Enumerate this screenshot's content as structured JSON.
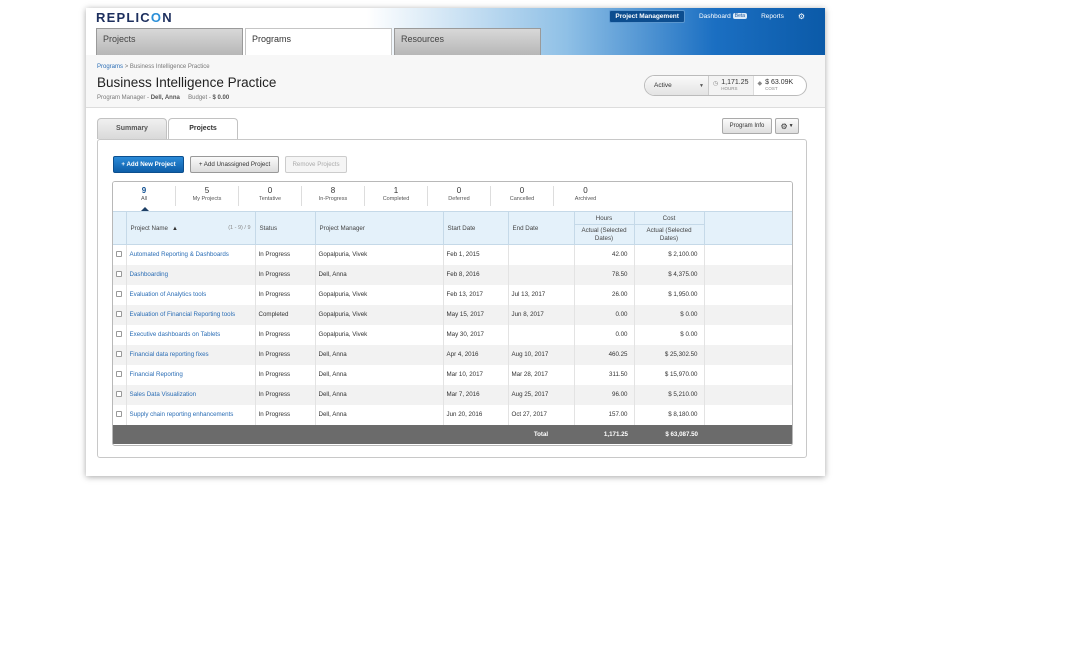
{
  "header": {
    "logo": {
      "left": "REPLIC",
      "o": "O",
      "right": "N"
    },
    "nav": [
      {
        "label": "Project Management",
        "active": true
      },
      {
        "label": "Dashboard",
        "badge": "Beta"
      },
      {
        "label": "Reports"
      }
    ],
    "settings_icon": "gear-icon"
  },
  "main_tabs": [
    {
      "label": "Projects"
    },
    {
      "label": "Programs",
      "active": true
    },
    {
      "label": "Resources"
    }
  ],
  "breadcrumb": {
    "link": "Programs",
    "sep": ">",
    "current": "Business Intelligence Practice"
  },
  "page": {
    "title": "Business Intelligence Practice",
    "manager_label": "Program Manager -",
    "manager": "Dell, Anna",
    "budget_label": "Budget -",
    "budget": "$ 0.00"
  },
  "summary": {
    "status": "Active",
    "hours_value": "1,171.25",
    "hours_label": "HOURS",
    "cost_value": "$ 63.09K",
    "cost_label": "COST"
  },
  "sub_tabs": [
    {
      "label": "Summary"
    },
    {
      "label": "Projects",
      "active": true
    }
  ],
  "toolbar": {
    "program_info": "Program Info",
    "add_new": "+ Add New Project",
    "add_unassigned": "+ Add Unassigned Project",
    "remove": "Remove Projects"
  },
  "filters": [
    {
      "count": "9",
      "label": "All",
      "active": true
    },
    {
      "count": "5",
      "label": "My Projects"
    },
    {
      "count": "0",
      "label": "Tentative"
    },
    {
      "count": "8",
      "label": "In-Progress"
    },
    {
      "count": "1",
      "label": "Completed"
    },
    {
      "count": "0",
      "label": "Deferred"
    },
    {
      "count": "0",
      "label": "Cancelled"
    },
    {
      "count": "0",
      "label": "Archived"
    }
  ],
  "table": {
    "columns": {
      "name": "Project Name",
      "count": "(1 - 9) / 9",
      "status": "Status",
      "manager": "Project Manager",
      "start": "Start Date",
      "end": "End Date",
      "hours_group": "Hours",
      "cost_group": "Cost",
      "hours_sub": "Actual (Selected Dates)",
      "cost_sub": "Actual (Selected Dates)"
    },
    "rows": [
      {
        "name": "Automated Reporting & Dashboards",
        "status": "In Progress",
        "manager": "Gopalpuria, Vivek",
        "start": "Feb 1, 2015",
        "end": "",
        "hours": "42.00",
        "cost": "$ 2,100.00"
      },
      {
        "name": "Dashboarding",
        "status": "In Progress",
        "manager": "Dell, Anna",
        "start": "Feb 8, 2016",
        "end": "",
        "hours": "78.50",
        "cost": "$ 4,375.00"
      },
      {
        "name": "Evaluation of Analytics tools",
        "status": "In Progress",
        "manager": "Gopalpuria, Vivek",
        "start": "Feb 13, 2017",
        "end": "Jul 13, 2017",
        "hours": "26.00",
        "cost": "$ 1,950.00"
      },
      {
        "name": "Evaluation of Financial Reporting tools",
        "status": "Completed",
        "manager": "Gopalpuria, Vivek",
        "start": "May 15, 2017",
        "end": "Jun 8, 2017",
        "hours": "0.00",
        "cost": "$ 0.00"
      },
      {
        "name": "Executive dashboards on Tablets",
        "status": "In Progress",
        "manager": "Gopalpuria, Vivek",
        "start": "May 30, 2017",
        "end": "",
        "hours": "0.00",
        "cost": "$ 0.00"
      },
      {
        "name": "Financial data reporting fixes",
        "status": "In Progress",
        "manager": "Dell, Anna",
        "start": "Apr 4, 2016",
        "end": "Aug 10, 2017",
        "hours": "460.25",
        "cost": "$ 25,302.50"
      },
      {
        "name": "Financial Reporting",
        "status": "In Progress",
        "manager": "Dell, Anna",
        "start": "Mar 10, 2017",
        "end": "Mar 28, 2017",
        "hours": "311.50",
        "cost": "$ 15,970.00"
      },
      {
        "name": "Sales Data Visualization",
        "status": "In Progress",
        "manager": "Dell, Anna",
        "start": "Mar 7, 2016",
        "end": "Aug 25, 2017",
        "hours": "96.00",
        "cost": "$ 5,210.00"
      },
      {
        "name": "Supply chain reporting enhancements",
        "status": "In Progress",
        "manager": "Dell, Anna",
        "start": "Jun 20, 2016",
        "end": "Oct 27, 2017",
        "hours": "157.00",
        "cost": "$ 8,180.00"
      }
    ],
    "total": {
      "label": "Total",
      "hours": "1,171.25",
      "cost": "$ 63,087.50"
    }
  }
}
